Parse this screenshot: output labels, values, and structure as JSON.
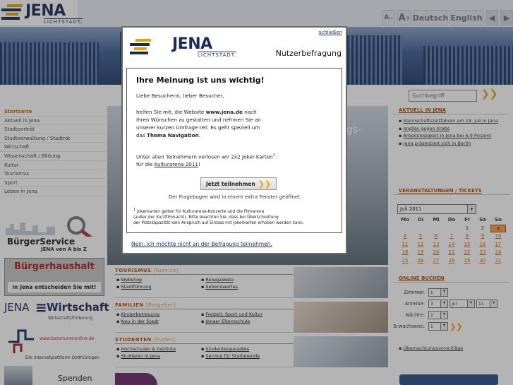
{
  "header": {
    "logo_word": "JENA",
    "logo_sub": "LICHTSTADT.",
    "font_small": "A",
    "font_small_mark": "−",
    "font_large": "A",
    "font_large_mark": "+",
    "lang_de": "Deutsch",
    "lang_en": "English",
    "back": "◀",
    "forward": "▶"
  },
  "search": {
    "placeholder": "Suchbegriff",
    "go": "❯❯"
  },
  "nav": {
    "items": [
      "Startseite",
      "Aktuell in Jena",
      "Stadtporträt",
      "Stadtverwaltung / Stadtrat",
      "Wirtschaft",
      "Wissenschaft / Bildung",
      "Kultur",
      "Tourismus",
      "Sport",
      "Leben in Jena"
    ]
  },
  "ads": {
    "buerger_title": "BürgerService",
    "buerger_sub": "JENA von A bis Z",
    "haushalt_title": "Bürgerhaushalt",
    "haushalt_sub": "in Jena entscheiden Sie mit!",
    "wirtschaft_a": "JENA",
    "wirtschaft_b": "Wirtschaft",
    "wirtschaft_sub": "Wirtschaftsförderung",
    "kommunen_url": "www.kommunenonline.de",
    "kommunen_sub": "Die Internetplattform Ostthüringen",
    "spenden": "Spenden"
  },
  "center": {
    "photo_text": "ngs-",
    "tourismus": {
      "title": "TOURISMUS",
      "sub": "[Service]",
      "col1": [
        "Webshop",
        "Stadtführung"
      ],
      "col2": [
        "Reisepakete",
        "Sehenswertes"
      ]
    },
    "familien": {
      "title": "FAMILIEN",
      "sub": "[Ratgeber]",
      "col1": [
        "Kinderbetreuung",
        "Neu in der Stadt"
      ],
      "col2": [
        "Freizeit, Sport und Kultur",
        "Jenaer Elternschule"
      ]
    },
    "studenten": {
      "title": "STUDENTEN",
      "sub": "[Futter]",
      "col1": [
        "Hochschulen & Institute",
        "Studieren in Jena"
      ],
      "col2": [
        "Studentenparadies",
        "Service für Studierende"
      ]
    }
  },
  "right": {
    "aktuell_title": "AKTUELL IN JENA",
    "aktuell": [
      "Mannschaftszeitfahren am 18. Juli in Jena",
      "Impfen gegen Krebs",
      "Arbeitslosigkeit in Jena bei 6,9 Prozent",
      "Jena präsentiert sich in Berlin"
    ],
    "veranst_title": "VERANSTALTUNGEN",
    "veranst_sep": "/",
    "tickets_title": "TICKETS",
    "month": "Juli 2011",
    "weekdays": [
      "Mo",
      "Di",
      "Mi",
      "Do",
      "Fr",
      "Sa",
      "So"
    ],
    "days": [
      "",
      "",
      "",
      "",
      "1",
      "2",
      "3",
      "4",
      "5",
      "6",
      "7",
      "8",
      "9",
      "10",
      "11",
      "12",
      "13",
      "14",
      "15",
      "16",
      "17",
      "18",
      "19",
      "20",
      "21",
      "22",
      "23",
      "24",
      "25",
      "26",
      "27",
      "28",
      "29",
      "30",
      "31"
    ],
    "booking_title": "ONLINE BUCHEN",
    "booking_labels": [
      "Zimmer:",
      "Anreise:",
      "Nächte:",
      "Erwachsene:"
    ],
    "booking_values": [
      "1",
      "3",
      "Jul",
      "11",
      "1",
      "1"
    ],
    "booking_go": "❯❯",
    "overnight_link": "Übernachtungsvorschläge"
  },
  "popup": {
    "close": "schließen",
    "logo_word": "JENA",
    "logo_sub": "LICHTSTADT.",
    "heading": "Nutzerbefragung",
    "title": "Ihre Meinung ist uns wichtig!",
    "greeting": "Liebe Besucherin, lieber Besucher,",
    "p1_a": "helfen Sie mit, die Website ",
    "p1_site": "www.jena.de",
    "p1_b": " nach",
    "p1_line2": "Ihren Wünschen zu gestalten und nehmen Sie an",
    "p1_line3": "unserer kurzen Umfrage teil. Es geht speziell um",
    "p1_c": "das ",
    "p1_topic": "Thema Navigation",
    "p1_d": ".",
    "p2_line1": "Unter allen Teilnehmern verlosen wir 2x2 Joker-Karten",
    "p2_sup": "1",
    "p2_a": "für die ",
    "p2_link": "Kulturarena 2011",
    "p2_b": "!",
    "join": "Jetzt teilnehmen",
    "join_arrow": "❯❯",
    "join_note": "Der Fragebogen wird in einem extra Fenster geöffnet.",
    "footnote_mark": "1",
    "footnote_line1": " Jokerkarten gelten für Kulturarena-Konzerte und die Filmarena",
    "footnote_line2": "(außer der Kurzfilmnacht). Bitte beachten Sie, dass bei Überschreitung",
    "footnote_line3": "der Platzkapazität kein Anspruch auf Einlass mit Jokerkarten erhoben werden kann.",
    "decline": "Nein, ich möchte nicht an der Befragung teilnehmen."
  }
}
